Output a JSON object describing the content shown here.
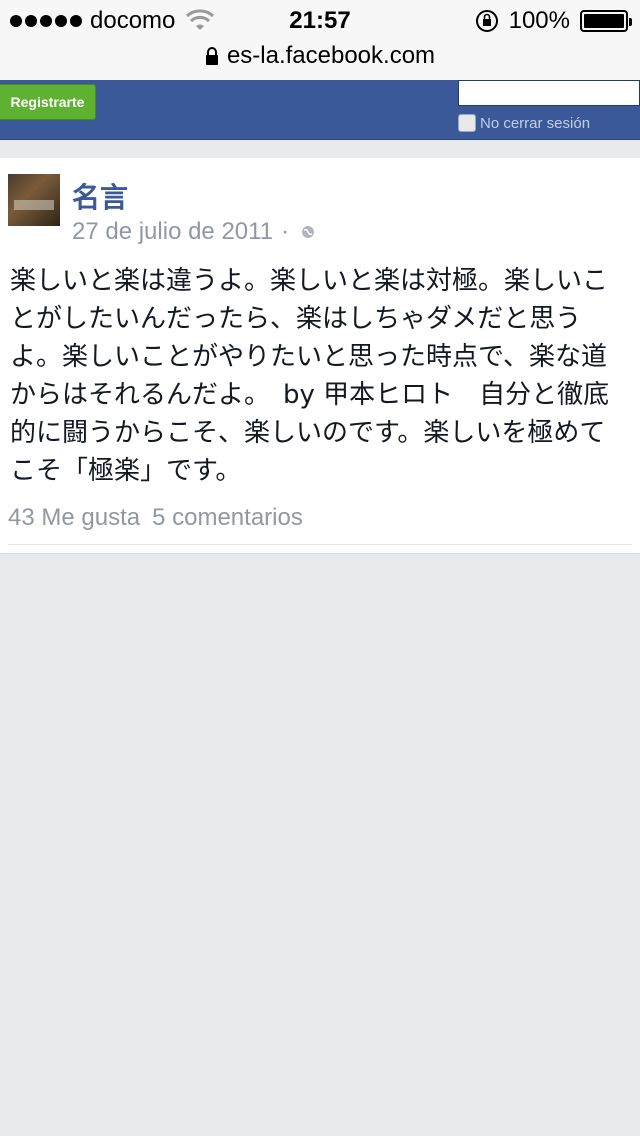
{
  "status_bar": {
    "carrier": "docomo",
    "time": "21:57",
    "battery": "100%"
  },
  "url_bar": {
    "url": "es-la.facebook.com"
  },
  "header": {
    "register_label": "Registrarte",
    "keep_logged_in_label": "No cerrar sesión"
  },
  "post": {
    "page_name": "名言",
    "date": "27 de julio de 2011",
    "separator": "·",
    "text": "楽しいと楽は違うよ。楽しいと楽は対極。楽しいことがしたいんだったら、楽はしちゃダメだと思うよ。楽しいことがやりたいと思った時点で、楽な道からはそれるんだよ。　by 甲本ヒロト　自分と徹底的に闘うからこそ、楽しいのです。楽しいを極めてこそ「極楽」です。",
    "likes": "43 Me gusta",
    "comments": "5 comentarios"
  },
  "colors": {
    "fb_blue": "#3b5998",
    "register_green": "#5fb131",
    "meta_gray": "#9197a3",
    "page_bg": "#e9eaed"
  }
}
